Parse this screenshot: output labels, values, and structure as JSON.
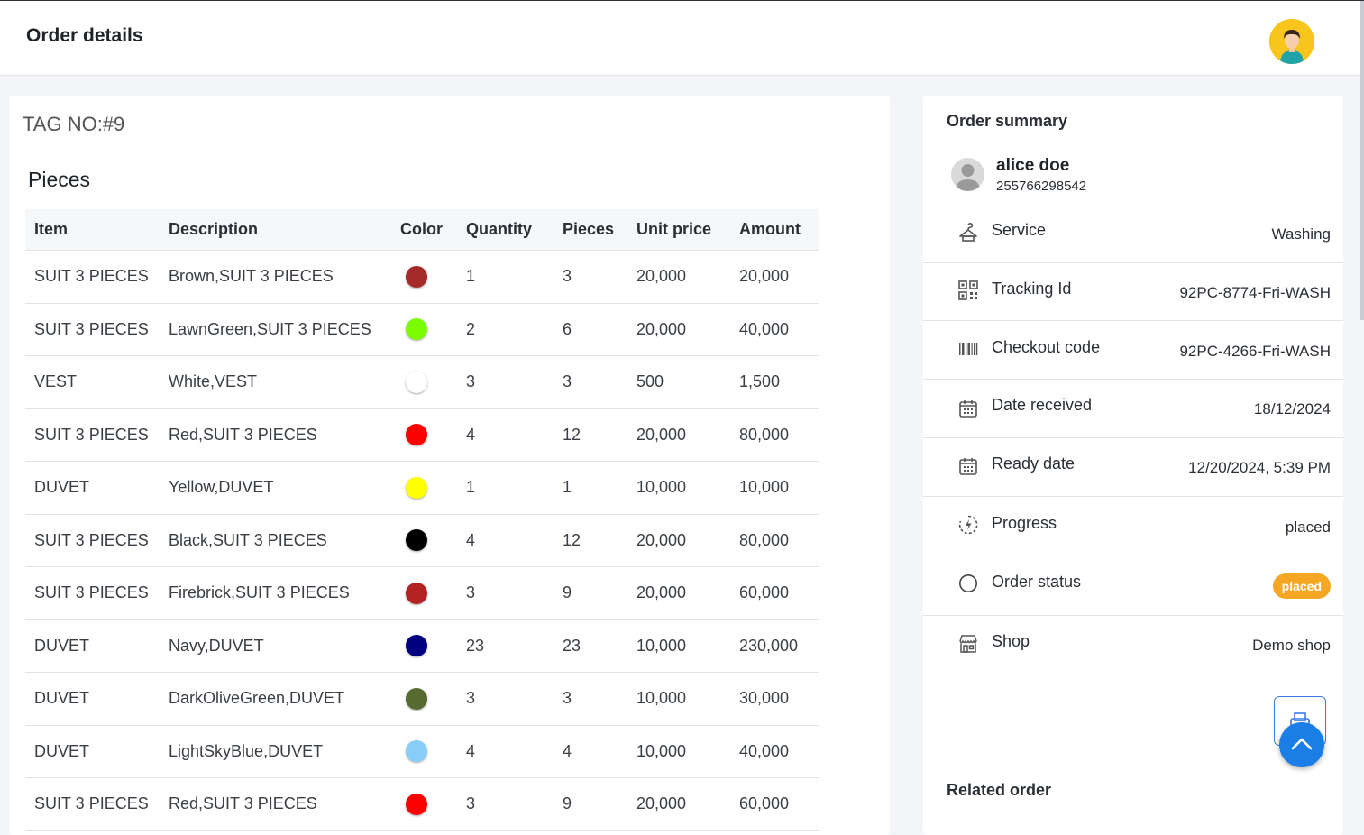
{
  "header": {
    "title": "Order details"
  },
  "tag": "TAG NO:#9",
  "pieces": {
    "title": "Pieces",
    "columns": [
      "Item",
      "Description",
      "Color",
      "Quantity",
      "Pieces",
      "Unit price",
      "Amount"
    ],
    "rows": [
      {
        "item": "SUIT 3 PIECES",
        "description": "Brown,SUIT 3 PIECES",
        "color": "#a52a2a",
        "quantity": "1",
        "pieces": "3",
        "unit_price": "20,000",
        "amount": "20,000"
      },
      {
        "item": "SUIT 3 PIECES",
        "description": "LawnGreen,SUIT 3 PIECES",
        "color": "#7cfc00",
        "quantity": "2",
        "pieces": "6",
        "unit_price": "20,000",
        "amount": "40,000"
      },
      {
        "item": "VEST",
        "description": "White,VEST",
        "color": "#ffffff",
        "quantity": "3",
        "pieces": "3",
        "unit_price": "500",
        "amount": "1,500"
      },
      {
        "item": "SUIT 3 PIECES",
        "description": "Red,SUIT 3 PIECES",
        "color": "#ff0000",
        "quantity": "4",
        "pieces": "12",
        "unit_price": "20,000",
        "amount": "80,000"
      },
      {
        "item": "DUVET",
        "description": "Yellow,DUVET",
        "color": "#ffff00",
        "quantity": "1",
        "pieces": "1",
        "unit_price": "10,000",
        "amount": "10,000"
      },
      {
        "item": "SUIT 3 PIECES",
        "description": "Black,SUIT 3 PIECES",
        "color": "#000000",
        "quantity": "4",
        "pieces": "12",
        "unit_price": "20,000",
        "amount": "80,000"
      },
      {
        "item": "SUIT 3 PIECES",
        "description": "Firebrick,SUIT 3 PIECES",
        "color": "#b22222",
        "quantity": "3",
        "pieces": "9",
        "unit_price": "20,000",
        "amount": "60,000"
      },
      {
        "item": "DUVET",
        "description": "Navy,DUVET",
        "color": "#000080",
        "quantity": "23",
        "pieces": "23",
        "unit_price": "10,000",
        "amount": "230,000"
      },
      {
        "item": "DUVET",
        "description": "DarkOliveGreen,DUVET",
        "color": "#556b2f",
        "quantity": "3",
        "pieces": "3",
        "unit_price": "10,000",
        "amount": "30,000"
      },
      {
        "item": "DUVET",
        "description": "LightSkyBlue,DUVET",
        "color": "#87cefa",
        "quantity": "4",
        "pieces": "4",
        "unit_price": "10,000",
        "amount": "40,000"
      },
      {
        "item": "SUIT 3 PIECES",
        "description": "Red,SUIT 3 PIECES",
        "color": "#ff0000",
        "quantity": "3",
        "pieces": "9",
        "unit_price": "20,000",
        "amount": "60,000"
      }
    ]
  },
  "summary": {
    "title": "Order summary",
    "customer": {
      "name": "alice doe",
      "phone": "255766298542"
    },
    "service": {
      "label": "Service",
      "value": "Washing",
      "icon": "hanger-icon"
    },
    "tracking": {
      "label": "Tracking Id",
      "value": "92PC-8774-Fri-WASH",
      "icon": "qr-code-icon"
    },
    "checkout": {
      "label": "Checkout code",
      "value": "92PC-4266-Fri-WASH",
      "icon": "barcode-icon"
    },
    "date_received": {
      "label": "Date received",
      "value": "18/12/2024",
      "icon": "calendar-icon"
    },
    "ready_date": {
      "label": "Ready date",
      "value": "12/20/2024, 5:39 PM",
      "icon": "calendar-icon"
    },
    "progress": {
      "label": "Progress",
      "value": "placed",
      "icon": "progress-icon"
    },
    "order_status": {
      "label": "Order status",
      "value": "placed",
      "icon": "circle-icon"
    },
    "shop": {
      "label": "Shop",
      "value": "Demo shop",
      "icon": "store-icon"
    },
    "related_title": "Related order"
  },
  "colors": {
    "accent": "#1a7ee6",
    "badge": "#f5a623",
    "avatar_bg": "#f8c51c"
  }
}
